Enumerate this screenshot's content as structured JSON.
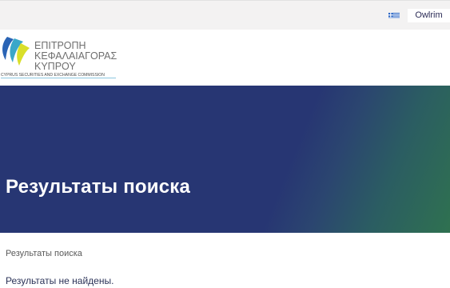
{
  "topbar": {
    "language_flag_icon": "greek-flag-icon",
    "language_button_label": "Owlrim"
  },
  "logo": {
    "line1": "ΕΠΙΤΡΟΠΗ",
    "line2": "ΚΕΦΑΛΑΙΑΓΟΡΑΣ",
    "line3": "ΚΥΠΡΟΥ",
    "tagline": "CYPRUS SECURITIES AND EXCHANGE COMMISSION"
  },
  "hero": {
    "title": "Результаты поиска"
  },
  "breadcrumb": {
    "current": "Результаты поиска"
  },
  "results": {
    "message": "Результаты не найдены."
  },
  "colors": {
    "hero_blue": "#273673",
    "hero_green": "#2f7150",
    "logo_blue": "#2a64b5",
    "logo_yellow": "#d9df2a",
    "logo_grey": "#6e6e6e"
  }
}
